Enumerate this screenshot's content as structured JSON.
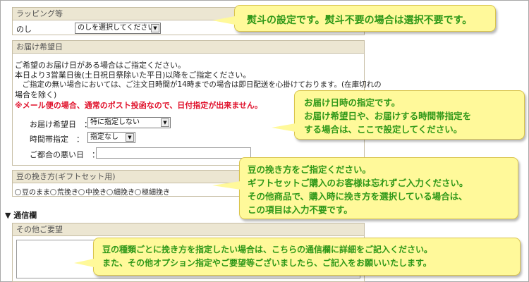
{
  "wrapping": {
    "header": "ラッピング等",
    "noshi_label": "のし",
    "noshi_select": "のしを選択してください"
  },
  "delivery": {
    "header": "お届け希望日",
    "info_lines": [
      "ご希望のお届け日がある場合はご指定ください。",
      "本日より3営業日後(土日祝日祭除いた平日)以降をご指定ください。",
      "　ご指定の無い場合においては、ご注文日時間が14時までの場合は即日配送を心掛けております。(在庫切れの",
      "場合を除く)"
    ],
    "warning": "※メール便の場合、通常のポスト投函なので、日付指定が出来ません。",
    "date_label": "お届け希望日　：",
    "date_select": "特に指定しない",
    "time_label": "時間帯指定　：",
    "time_select": "指定なし",
    "inconvenient_label": "ご都合の悪い日　："
  },
  "grind": {
    "header": "豆の挽き方(ギフトセット用)",
    "options": [
      "豆のまま",
      "荒挽き",
      "中挽き",
      "細挽き",
      "極細挽き"
    ]
  },
  "comments": {
    "section_title": "▼ 通信欄",
    "header": "その他ご要望"
  },
  "callouts": {
    "noshi": [
      "熨斗の設定です。熨斗不要の場合は選択不要です。"
    ],
    "delivery": [
      "お届け日時の指定です。",
      "お届け希望日や、お届けする時間帯指定を",
      "する場合は、ここで設定してください。"
    ],
    "grind": [
      "豆の挽き方をご指定ください。",
      "ギフトセットご購入のお客様は忘れずご入力ください。",
      "その他商品で、購入時に挽き方を選択している場合は、",
      "この項目は入力不要です。"
    ],
    "comments": [
      "豆の種類ごとに挽き方を指定したい場合は、こちらの通信欄に詳細をご記入ください。",
      "また、その他オプション指定やご要望等ございましたら、ご記入をお願いいたします。"
    ]
  },
  "colors": {
    "warning_red": "#e0102a",
    "callout_bg": "#fff99a",
    "callout_text": "#2f9818",
    "panel_header_bg": "#ece6d2"
  }
}
